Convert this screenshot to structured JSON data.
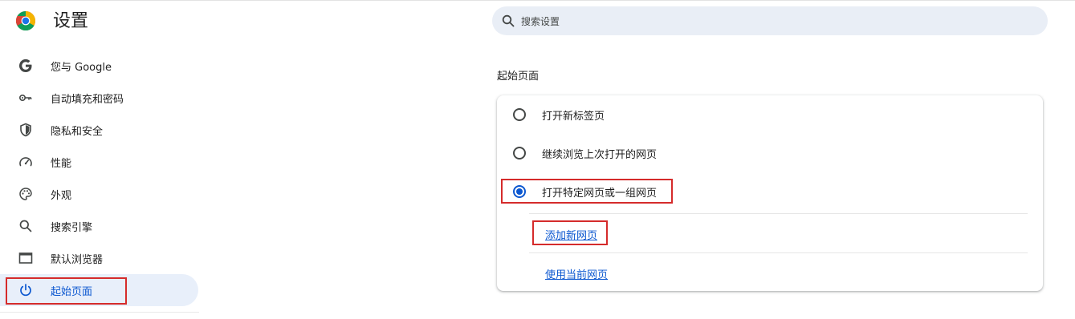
{
  "header": {
    "title": "设置"
  },
  "search": {
    "placeholder": "搜索设置",
    "value": ""
  },
  "sidebar": {
    "items": [
      {
        "label": "您与 Google",
        "icon": "google-g-icon"
      },
      {
        "label": "自动填充和密码",
        "icon": "key-icon"
      },
      {
        "label": "隐私和安全",
        "icon": "shield-icon"
      },
      {
        "label": "性能",
        "icon": "speedometer-icon"
      },
      {
        "label": "外观",
        "icon": "palette-icon"
      },
      {
        "label": "搜索引擎",
        "icon": "search-icon"
      },
      {
        "label": "默认浏览器",
        "icon": "browser-window-icon"
      },
      {
        "label": "起始页面",
        "icon": "power-icon",
        "active": true
      }
    ]
  },
  "section": {
    "title": "起始页面",
    "options": [
      {
        "label": "打开新标签页",
        "checked": false
      },
      {
        "label": "继续浏览上次打开的网页",
        "checked": false
      },
      {
        "label": "打开特定网页或一组网页",
        "checked": true
      }
    ],
    "add_page_link": "添加新网页",
    "use_current_link": "使用当前网页"
  },
  "colors": {
    "accent": "#0b57d0",
    "active_nav_bg": "#e8effa",
    "search_bg": "#e9eef6",
    "highlight": "#d52b2b"
  }
}
